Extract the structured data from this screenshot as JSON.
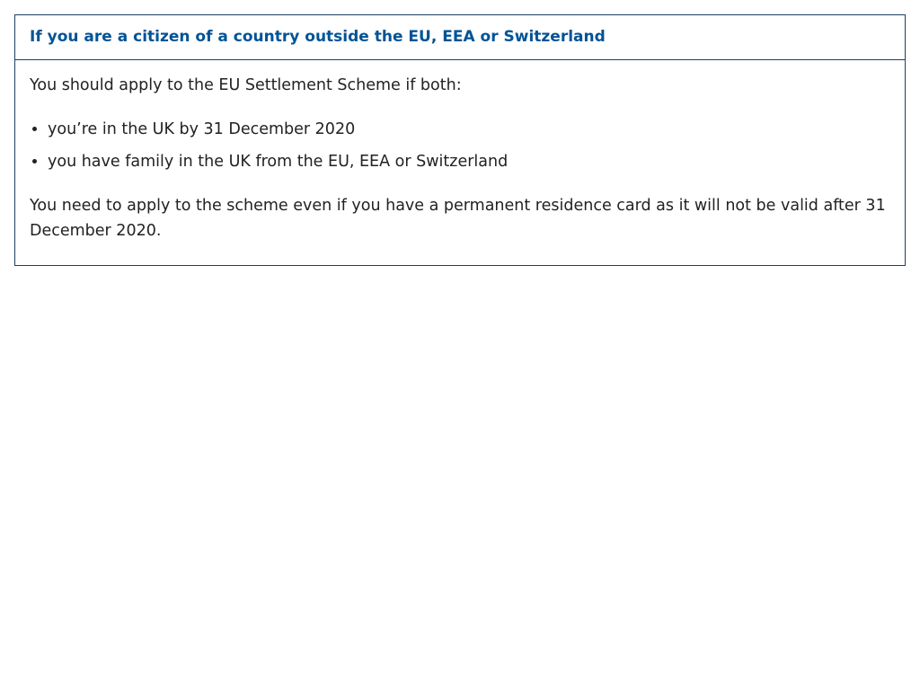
{
  "panel": {
    "title": "If you are a citizen of a country outside the EU, EEA or Switzerland",
    "intro": "You should apply to the EU Settlement Scheme if both:",
    "bullets": [
      "you’re in the UK by 31 December 2020",
      "you have family in the UK from the EU, EEA or Switzerland"
    ],
    "note": "You need to apply to the scheme even if you have a permanent residence card as it will not be valid after 31 December 2020."
  },
  "colors": {
    "title": "#005396",
    "border": "#1d3f66",
    "text": "#222222",
    "background": "#ffffff"
  }
}
